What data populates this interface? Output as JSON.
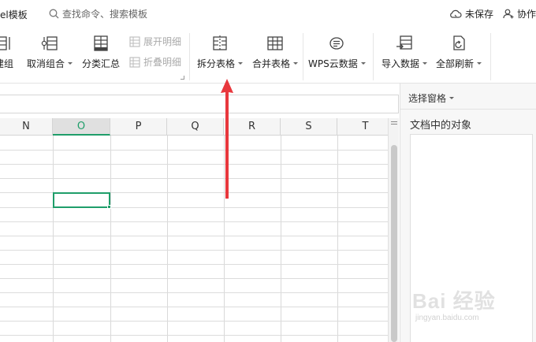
{
  "topbar": {
    "template_label": "el模板",
    "search_placeholder": "查找命令、搜索模板",
    "unsaved_label": "未保存",
    "collab_label": "协作"
  },
  "ribbon": {
    "buttons": [
      {
        "label": "建组",
        "icon": "group-icon"
      },
      {
        "label": "取消组合",
        "icon": "ungroup-icon"
      },
      {
        "label": "分类汇总",
        "icon": "subtotal-icon"
      },
      {
        "label": "拆分表格",
        "icon": "split-table-icon"
      },
      {
        "label": "合并表格",
        "icon": "merge-table-icon"
      },
      {
        "label": "WPS云数据",
        "icon": "wps-cloud-data-icon"
      },
      {
        "label": "导入数据",
        "icon": "import-data-icon"
      },
      {
        "label": "全部刷新",
        "icon": "refresh-all-icon"
      }
    ],
    "expand_detail": "展开明细",
    "collapse_detail": "折叠明细"
  },
  "grid": {
    "columns": [
      "N",
      "O",
      "P",
      "Q",
      "R",
      "S",
      "T"
    ],
    "selected_column": "O"
  },
  "pane": {
    "title": "选择窗格",
    "heading": "文档中的对象"
  },
  "watermark": {
    "brand": "Bai 经验",
    "url": "jingyan.baidu.com"
  },
  "colors": {
    "accent": "#1f9e6a",
    "annotation_arrow": "#e8383d"
  }
}
